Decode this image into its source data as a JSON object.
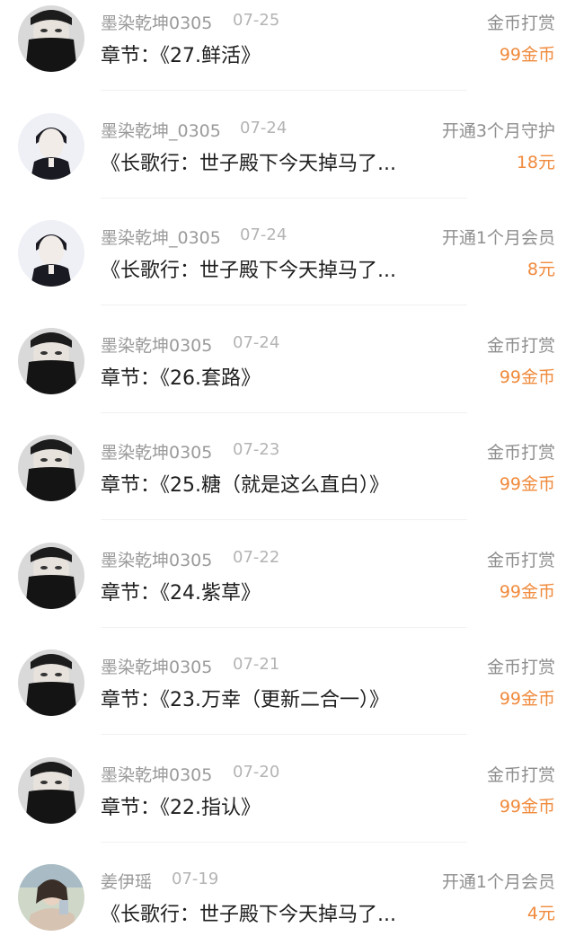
{
  "records": [
    {
      "user": "墨染乾坤0305",
      "date": "07-25",
      "item": "章节：《27.鲜活》",
      "type": "金币打赏",
      "amount": "99金币",
      "avatar": "masked-man-avatar"
    },
    {
      "user": "墨染乾坤_0305",
      "date": "07-24",
      "item": "《长歌行：世子殿下今天掉马了...",
      "type": "开通3个月守护",
      "amount": "18元",
      "avatar": "young-man-portrait-avatar"
    },
    {
      "user": "墨染乾坤_0305",
      "date": "07-24",
      "item": "《长歌行：世子殿下今天掉马了...",
      "type": "开通1个月会员",
      "amount": "8元",
      "avatar": "young-man-portrait-avatar"
    },
    {
      "user": "墨染乾坤0305",
      "date": "07-24",
      "item": "章节：《26.套路》",
      "type": "金币打赏",
      "amount": "99金币",
      "avatar": "masked-man-avatar"
    },
    {
      "user": "墨染乾坤0305",
      "date": "07-23",
      "item": "章节：《25.糖（就是这么直白）》",
      "type": "金币打赏",
      "amount": "99金币",
      "avatar": "masked-man-avatar"
    },
    {
      "user": "墨染乾坤0305",
      "date": "07-22",
      "item": "章节：《24.紫草》",
      "type": "金币打赏",
      "amount": "99金币",
      "avatar": "masked-man-avatar"
    },
    {
      "user": "墨染乾坤0305",
      "date": "07-21",
      "item": "章节：《23.万幸（更新二合一）》",
      "type": "金币打赏",
      "amount": "99金币",
      "avatar": "masked-man-avatar"
    },
    {
      "user": "墨染乾坤0305",
      "date": "07-20",
      "item": "章节：《22.指认》",
      "type": "金币打赏",
      "amount": "99金币",
      "avatar": "masked-man-avatar"
    },
    {
      "user": "姜伊瑶",
      "date": "07-19",
      "item": "《长歌行：世子殿下今天掉马了...",
      "type": "开通1个月会员",
      "amount": "4元",
      "avatar": "woman-photo-avatar"
    }
  ],
  "colors": {
    "amount": "#f08a3c",
    "username": "#9a9a9a",
    "date": "#b4b4b4",
    "title": "#1e1e1e",
    "type": "#8e8e8e"
  }
}
